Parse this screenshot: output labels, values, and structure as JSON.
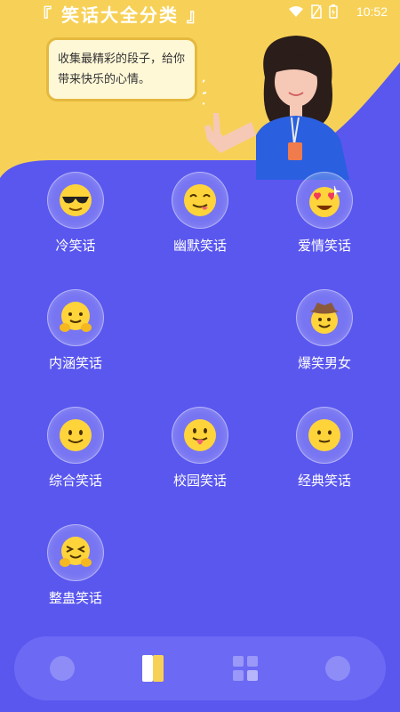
{
  "status": {
    "time": "10:52"
  },
  "header": {
    "title": "『 笑话大全分类 』",
    "bubble_text": "收集最精彩的段子，给你带来快乐的心情。"
  },
  "categories": [
    {
      "label": "冷笑话",
      "icon": "sunglasses-emoji-icon"
    },
    {
      "label": "幽默笑话",
      "icon": "wink-tongue-emoji-icon"
    },
    {
      "label": "爱情笑话",
      "icon": "heart-eyes-emoji-icon"
    },
    {
      "label": "内涵笑话",
      "icon": "hugging-emoji-icon"
    },
    {
      "label": "爆笑男女",
      "icon": "cowboy-emoji-icon"
    },
    {
      "label": "综合笑话",
      "icon": "smile-emoji-icon"
    },
    {
      "label": "校园笑话",
      "icon": "tongue-emoji-icon"
    },
    {
      "label": "经典笑话",
      "icon": "slight-smile-emoji-icon"
    },
    {
      "label": "整蛊笑话",
      "icon": "squint-hug-emoji-icon"
    }
  ],
  "nav": {
    "items": [
      "home-nav-icon",
      "category-nav-icon",
      "grid-nav-icon",
      "profile-nav-icon"
    ],
    "active": "category-nav-icon"
  }
}
